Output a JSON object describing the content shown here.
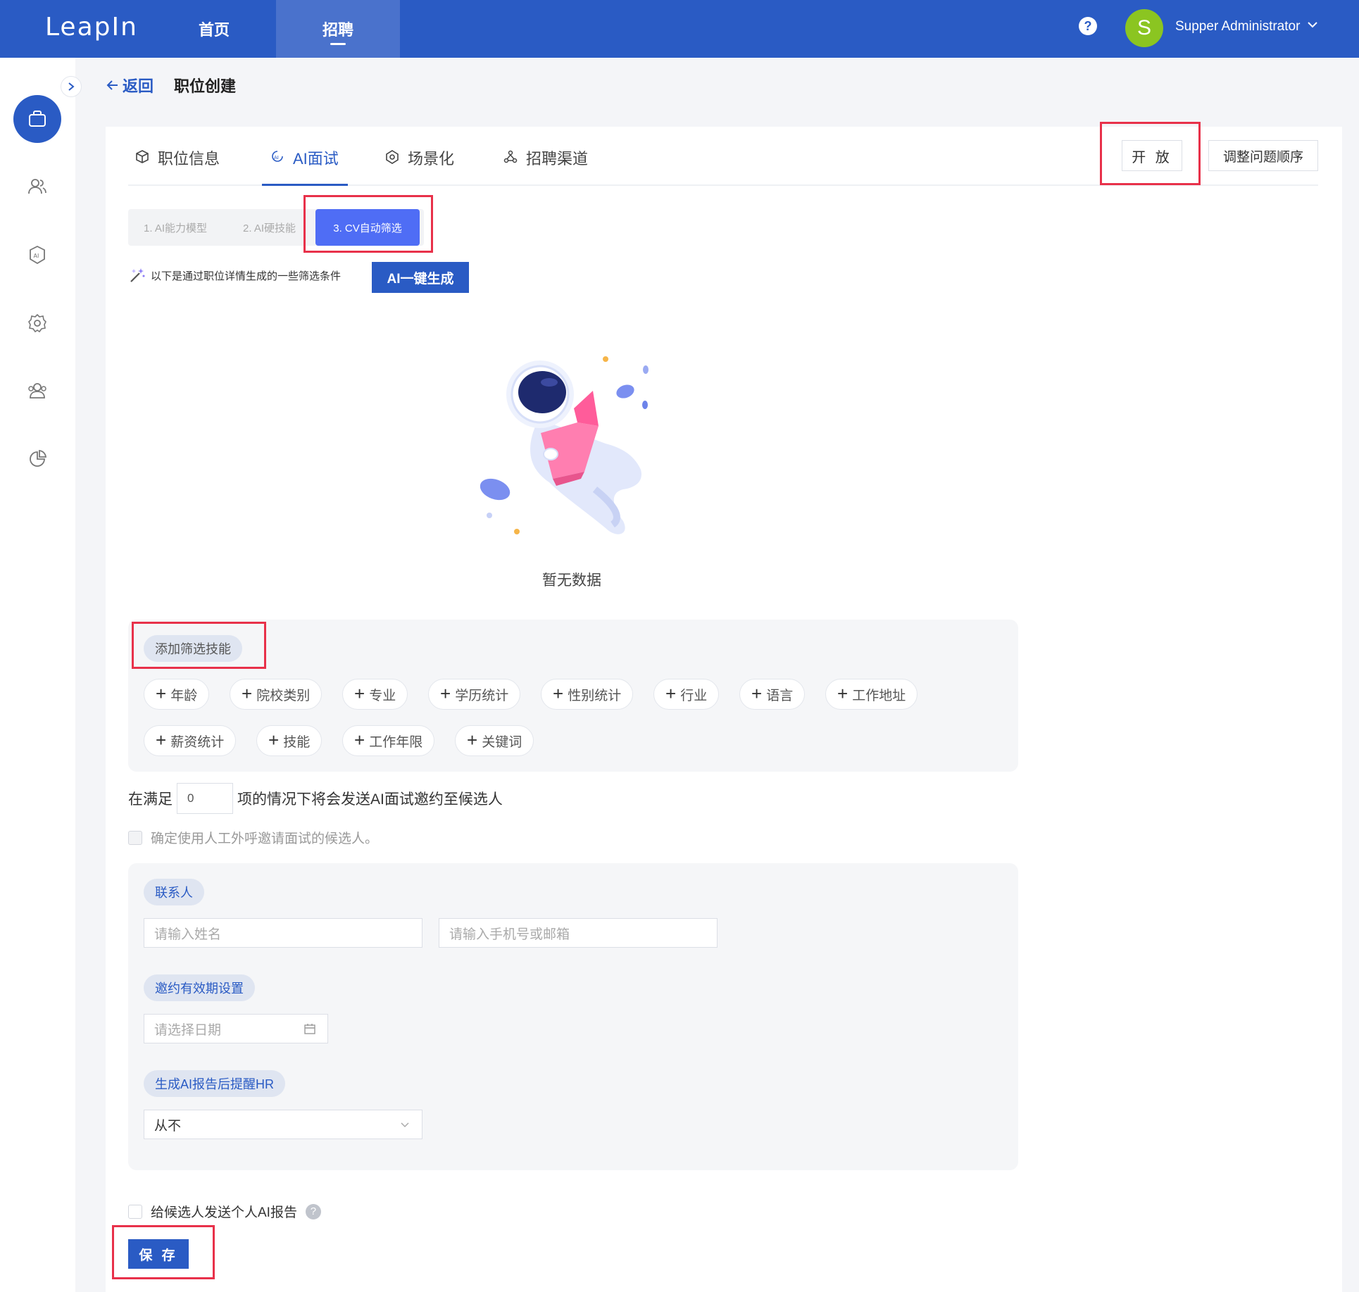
{
  "header": {
    "logo": "LeapIn",
    "nav": [
      {
        "label": "首页"
      },
      {
        "label": "招聘"
      }
    ],
    "help": "?",
    "avatar_letter": "S",
    "username": "Supper Administrator"
  },
  "breadcrumb": {
    "back": "返回",
    "title": "职位创建"
  },
  "tabs": [
    {
      "label": "职位信息",
      "icon": "cube-icon"
    },
    {
      "label": "AI面试",
      "icon": "ai-interview-icon"
    },
    {
      "label": "场景化",
      "icon": "scene-icon"
    },
    {
      "label": "招聘渠道",
      "icon": "channel-icon"
    }
  ],
  "actions": {
    "open": "开 放",
    "reorder": "调整问题顺序"
  },
  "steps": [
    "1. AI能力模型",
    "2. AI硬技能",
    "3. CV自动筛选"
  ],
  "ai_hint": "以下是通过职位详情生成的一些筛选条件",
  "ai_generate": "AI一键生成",
  "empty": "暂无数据",
  "skills": {
    "label": "添加筛选技能",
    "chips": [
      "年龄",
      "院校类别",
      "专业",
      "学历统计",
      "性别统计",
      "行业",
      "语言",
      "工作地址",
      "薪资统计",
      "技能",
      "工作年限",
      "关键词"
    ]
  },
  "condition": {
    "prefix": "在满足",
    "value": "0",
    "suffix": "项的情况下将会发送AI面试邀约至候选人"
  },
  "manual_call": "确定使用人工外呼邀请面试的候选人。",
  "contact": {
    "label": "联系人",
    "name_placeholder": "请输入姓名",
    "phone_placeholder": "请输入手机号或邮箱"
  },
  "validity": {
    "label": "邀约有效期设置",
    "date_placeholder": "请选择日期"
  },
  "remind": {
    "label": "生成AI报告后提醒HR",
    "value": "从不"
  },
  "send_report": "给候选人发送个人AI报告",
  "save": "保 存",
  "colors": {
    "brand": "#2a5bc4",
    "step_active": "#4f6df5",
    "highlight": "#e8314a"
  }
}
